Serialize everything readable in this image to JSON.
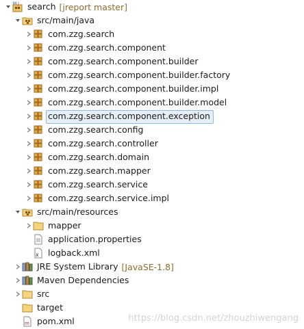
{
  "project": {
    "name": "search",
    "decoration": "[jreport master]"
  },
  "source_folders": [
    {
      "label": "src/main/java"
    },
    {
      "label": "src/main/resources"
    }
  ],
  "packages": [
    {
      "label": "com.zzg.search"
    },
    {
      "label": "com.zzg.search.component"
    },
    {
      "label": "com.zzg.search.component.builder"
    },
    {
      "label": "com.zzg.search.component.builder.factory"
    },
    {
      "label": "com.zzg.search.component.builder.impl"
    },
    {
      "label": "com.zzg.search.component.builder.model"
    },
    {
      "label": "com.zzg.search.component.exception",
      "selected": true
    },
    {
      "label": "com.zzg.search.config"
    },
    {
      "label": "com.zzg.search.controller"
    },
    {
      "label": "com.zzg.search.domain"
    },
    {
      "label": "com.zzg.search.mapper"
    },
    {
      "label": "com.zzg.search.service"
    },
    {
      "label": "com.zzg.search.service.impl"
    }
  ],
  "resources": [
    {
      "label": "mapper",
      "icon": "folder-icon"
    },
    {
      "label": "application.properties",
      "icon": "properties-file-icon"
    },
    {
      "label": "logback.xml",
      "icon": "xml-file-icon"
    }
  ],
  "libraries": [
    {
      "label": "JRE System Library",
      "decoration": "[JavaSE-1.8]"
    },
    {
      "label": "Maven Dependencies"
    }
  ],
  "bottom_items": [
    {
      "label": "src",
      "icon": "folder-icon"
    },
    {
      "label": "target",
      "icon": "folder-icon"
    },
    {
      "label": "pom.xml",
      "icon": "pom-file-icon"
    }
  ],
  "watermark": "https://blog.csdn.net/zhouzhiwengang",
  "colors": {
    "selection_bg": "#e6eef8",
    "selection_border": "#8fb7e0",
    "decoration": "#8f6b2e"
  }
}
